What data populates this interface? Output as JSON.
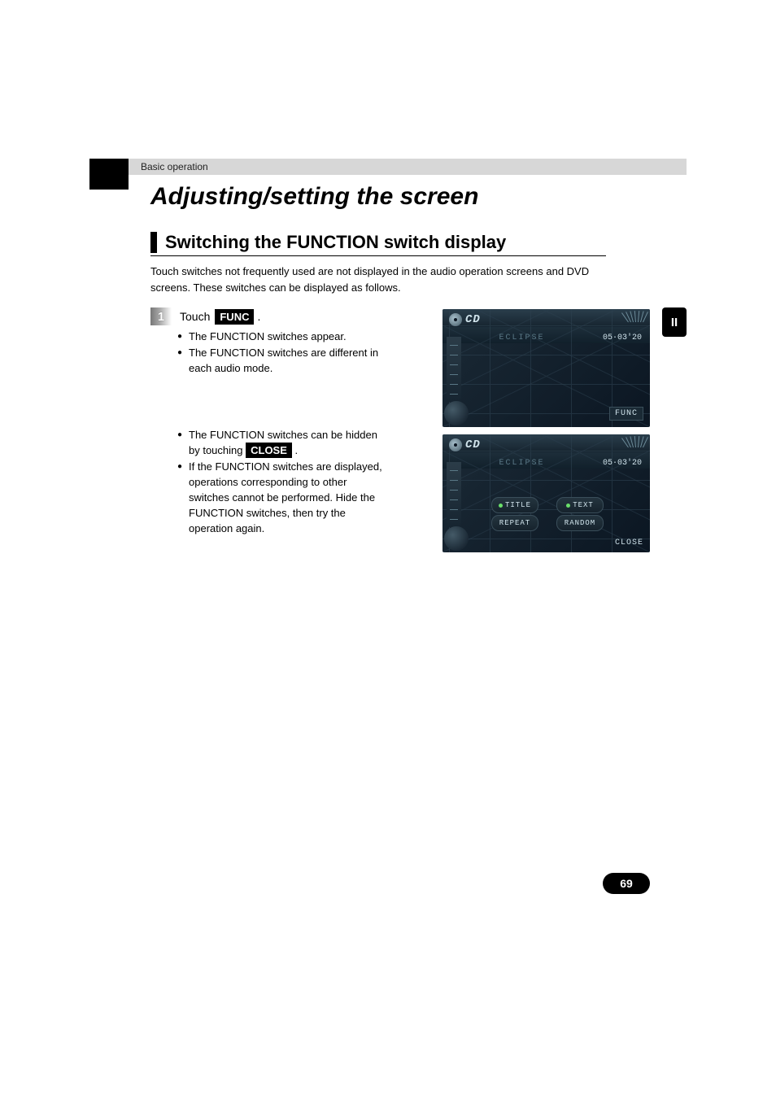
{
  "header": {
    "category": "Basic operation"
  },
  "title": "Adjusting/setting the screen",
  "section_title": "Switching the FUNCTION switch display",
  "intro": "Touch switches not frequently used are not displayed in the audio operation screens and DVD screens. These switches can be displayed as follows.",
  "step": {
    "number": "1",
    "prefix": "Touch ",
    "button_label": "FUNC",
    "suffix": " ."
  },
  "bullets_a": [
    "The FUNCTION switches appear.",
    "The FUNCTION switches are different in each audio mode."
  ],
  "bullets_b_1_prefix": "The FUNCTION switches can be hidden by touching ",
  "bullets_b_1_button": "CLOSE",
  "bullets_b_1_suffix": " .",
  "bullets_b_2": "If the FUNCTION switches are displayed, operations corresponding to other switches cannot be performed. Hide the FUNCTION switches, then try the operation again.",
  "side_tab": "II",
  "device": {
    "source_label": "CD",
    "track_name": "ECLIPSE",
    "time": "05·03'20",
    "func_label": "FUNC",
    "close_label": "CLOSE",
    "buttons": {
      "title": "TITLE",
      "text": "TEXT",
      "repeat": "REPEAT",
      "random": "RANDOM"
    }
  },
  "page_number": "69"
}
